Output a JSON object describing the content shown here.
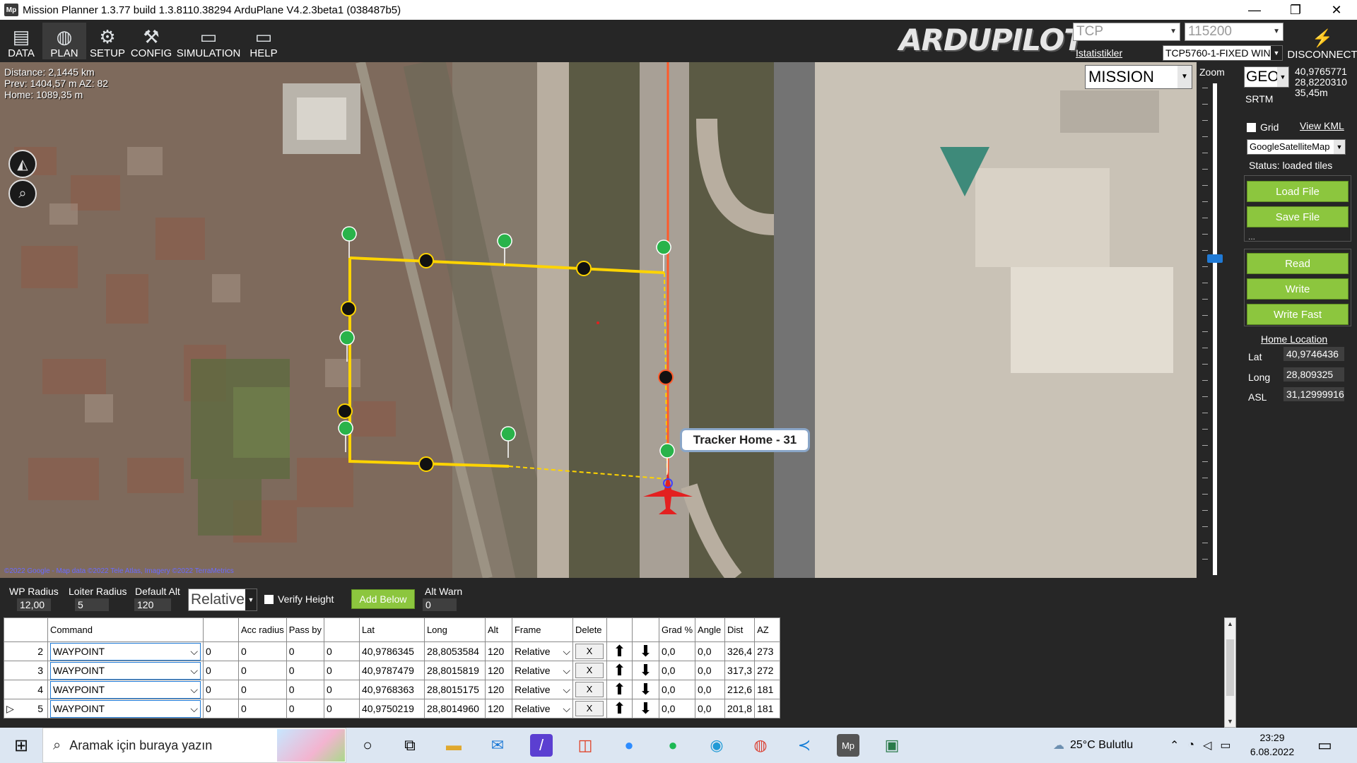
{
  "window": {
    "title": "Mission Planner 1.3.77 build 1.3.8110.38294 ArduPlane V4.2.3beta1 (038487b5)",
    "app_icon": "Mp",
    "minimize": "—",
    "maximize": "❐",
    "close": "✕"
  },
  "toolbar": {
    "items": [
      {
        "label": "DATA",
        "icon": "data-icon"
      },
      {
        "label": "PLAN",
        "icon": "globe-icon"
      },
      {
        "label": "SETUP",
        "icon": "gears-icon"
      },
      {
        "label": "CONFIG",
        "icon": "wrench-icon"
      },
      {
        "label": "SIMULATION",
        "icon": "monitor-plane-icon"
      },
      {
        "label": "HELP",
        "icon": "help-monitor-icon"
      }
    ],
    "logo": "ARDUPILOT",
    "connection": {
      "port": "TCP",
      "baud": "115200",
      "stats_link": "Istatistikler",
      "link_name": "TCP5760-1-FIXED WIN",
      "disconnect": "DISCONNECT"
    }
  },
  "map": {
    "distance": "Distance: 2,1445 km",
    "prev": "Prev: 1404,57 m AZ: 82",
    "home": "Home: 1089,35 m",
    "mode": "MISSION",
    "tracker_label": "Tracker Home - 31",
    "copyright": "©2022 Google - Map data ©2022 Tele Atlas, Imagery ©2022 TerraMetrics",
    "zoom_label": "Zoom"
  },
  "side": {
    "coord_format": "GEO",
    "lat": "40,9765771",
    "lng": "28,8220310",
    "alt": "35,45m",
    "srtm": "SRTM",
    "grid": "Grid",
    "view_kml": "View KML",
    "map_type": "GoogleSatelliteMap",
    "status": "Status: loaded tiles",
    "load_file": "Load File",
    "save_file": "Save File",
    "dots": "...",
    "read": "Read",
    "write": "Write",
    "write_fast": "Write Fast",
    "home_location": "Home Location",
    "home_lat_label": "Lat",
    "home_lat": "40,9746436",
    "home_long_label": "Long",
    "home_long": "28,809325",
    "home_asl_label": "ASL",
    "home_asl": "31,12999916"
  },
  "config": {
    "wp_radius_label": "WP Radius",
    "wp_radius": "12,00",
    "loiter_radius_label": "Loiter Radius",
    "loiter_radius": "5",
    "default_alt_label": "Default Alt",
    "default_alt": "120",
    "frame": "Relative",
    "verify_height": "Verify Height",
    "add_below": "Add Below",
    "alt_warn_label": "Alt Warn",
    "alt_warn": "0",
    "collapse": "v"
  },
  "table": {
    "headers": [
      "",
      "Command",
      "",
      "Acc radius",
      "Pass by",
      "",
      "Lat",
      "Long",
      "Alt",
      "Frame",
      "Delete",
      "",
      "",
      "Grad %",
      "Angle",
      "Dist",
      "AZ"
    ],
    "rows": [
      {
        "num": "2",
        "command": "WAYPOINT",
        "p1": "0",
        "p2": "0",
        "p3": "0",
        "p4": "0",
        "lat": "40,9786345",
        "lng": "28,8053584",
        "alt": "120",
        "frame": "Relative",
        "del": "X",
        "grad": "0,0",
        "angle": "0,0",
        "dist": "326,4",
        "az": "273"
      },
      {
        "num": "3",
        "command": "WAYPOINT",
        "p1": "0",
        "p2": "0",
        "p3": "0",
        "p4": "0",
        "lat": "40,9787479",
        "lng": "28,8015819",
        "alt": "120",
        "frame": "Relative",
        "del": "X",
        "grad": "0,0",
        "angle": "0,0",
        "dist": "317,3",
        "az": "272"
      },
      {
        "num": "4",
        "command": "WAYPOINT",
        "p1": "0",
        "p2": "0",
        "p3": "0",
        "p4": "0",
        "lat": "40,9768363",
        "lng": "28,8015175",
        "alt": "120",
        "frame": "Relative",
        "del": "X",
        "grad": "0,0",
        "angle": "0,0",
        "dist": "212,6",
        "az": "181"
      },
      {
        "num": "5",
        "command": "WAYPOINT",
        "p1": "0",
        "p2": "0",
        "p3": "0",
        "p4": "0",
        "lat": "40,9750219",
        "lng": "28,8014960",
        "alt": "120",
        "frame": "Relative",
        "del": "X",
        "grad": "0,0",
        "angle": "0,0",
        "dist": "201,8",
        "az": "181"
      }
    ]
  },
  "taskbar": {
    "search_placeholder": "Aramak için buraya yazın",
    "weather": "25°C  Bulutlu",
    "time": "23:29",
    "date": "6.08.2022",
    "apps": [
      "cortana-icon",
      "task-view-icon",
      "file-explorer-icon",
      "mail-icon",
      "visual-studio-icon",
      "office-icon",
      "zoom-icon",
      "spotify-icon",
      "edge-icon",
      "chrome-icon",
      "vscode-icon",
      "mission-planner-icon",
      "app-icon"
    ]
  }
}
